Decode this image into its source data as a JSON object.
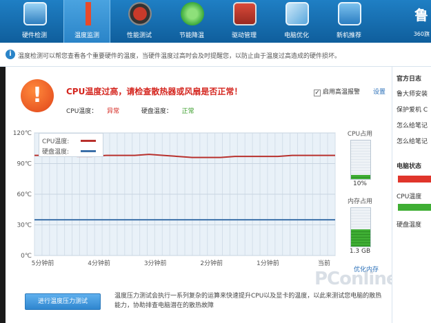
{
  "toolbar": {
    "items": [
      {
        "label": "硬件检测",
        "icon": "monitor-icon"
      },
      {
        "label": "温度监测",
        "icon": "thermometer-icon"
      },
      {
        "label": "性能测试",
        "icon": "speedometer-icon"
      },
      {
        "label": "节能降温",
        "icon": "leaf-icon"
      },
      {
        "label": "驱动管理",
        "icon": "driver-icon"
      },
      {
        "label": "电脑优化",
        "icon": "optimize-icon"
      },
      {
        "label": "新机推荐",
        "icon": "new-pc-icon"
      }
    ],
    "active_index": 1,
    "brand_logo": "鲁",
    "brand_sub": "360旗"
  },
  "info": {
    "text": "温度检测可以帮您查看各个重要硬件的温度，当硬件温度过高时会及时提醒您，以防止由于温度过高造成的硬件损坏。"
  },
  "warning": {
    "title": "CPU温度过高，请检查散热器或风扇是否正常！",
    "cpu_label": "CPU温度：",
    "cpu_status": "异常",
    "disk_label": "硬盘温度：",
    "disk_status": "正常",
    "alarm_label": "启用高温报警",
    "alarm_checked": true,
    "settings_label": "设置"
  },
  "chart_data": {
    "type": "line",
    "x": [
      "5分钟前",
      "4分钟前",
      "3分钟前",
      "2分钟前",
      "1分钟前",
      "当前"
    ],
    "y_ticks": [
      "120℃",
      "90℃",
      "60℃",
      "30℃",
      "0℃"
    ],
    "ylim": [
      0,
      120
    ],
    "grid": true,
    "legend_position": "top-left",
    "series": [
      {
        "name": "CPU温度:",
        "color": "#b8302c",
        "values": [
          98,
          98,
          98,
          97,
          97,
          98,
          98,
          98,
          99,
          98,
          97,
          96,
          96,
          96,
          97,
          97,
          97,
          97,
          98,
          98,
          98,
          98
        ]
      },
      {
        "name": "硬盘温度:",
        "color": "#3b6fa8",
        "values": [
          35,
          35,
          35,
          35,
          35,
          35,
          35,
          35,
          35,
          35,
          35,
          35,
          35,
          35,
          35,
          35,
          35,
          35,
          35,
          35,
          35,
          35
        ]
      }
    ]
  },
  "meters": {
    "cpu": {
      "title": "CPU占用",
      "value_text": "10%",
      "fraction": 0.1
    },
    "memory": {
      "title": "内存占用",
      "value_text": "1.3 GB",
      "fraction": 0.45
    }
  },
  "optimize_link": "优化内存",
  "bottom": {
    "button": "进行温度压力测试",
    "desc": "温度压力测试会执行一系列复杂的运算来快速提升CPU以及显卡的温度，以此来测试您电脑的散热能力，协助排查电脑潜在的散热故障"
  },
  "watermark": "PConline",
  "right_panel": {
    "blog_title": "官方日志",
    "blog_items": [
      "鲁大师安装",
      "保护爱机 C",
      "怎么给笔记",
      "怎么给笔记"
    ],
    "status_title": "电脑状态",
    "cpu_temp_label": "CPU温度",
    "disk_temp_label": "硬盘温度",
    "cpu_bar_color": "#e0352b",
    "disk_bar_color": "#3fae34"
  }
}
